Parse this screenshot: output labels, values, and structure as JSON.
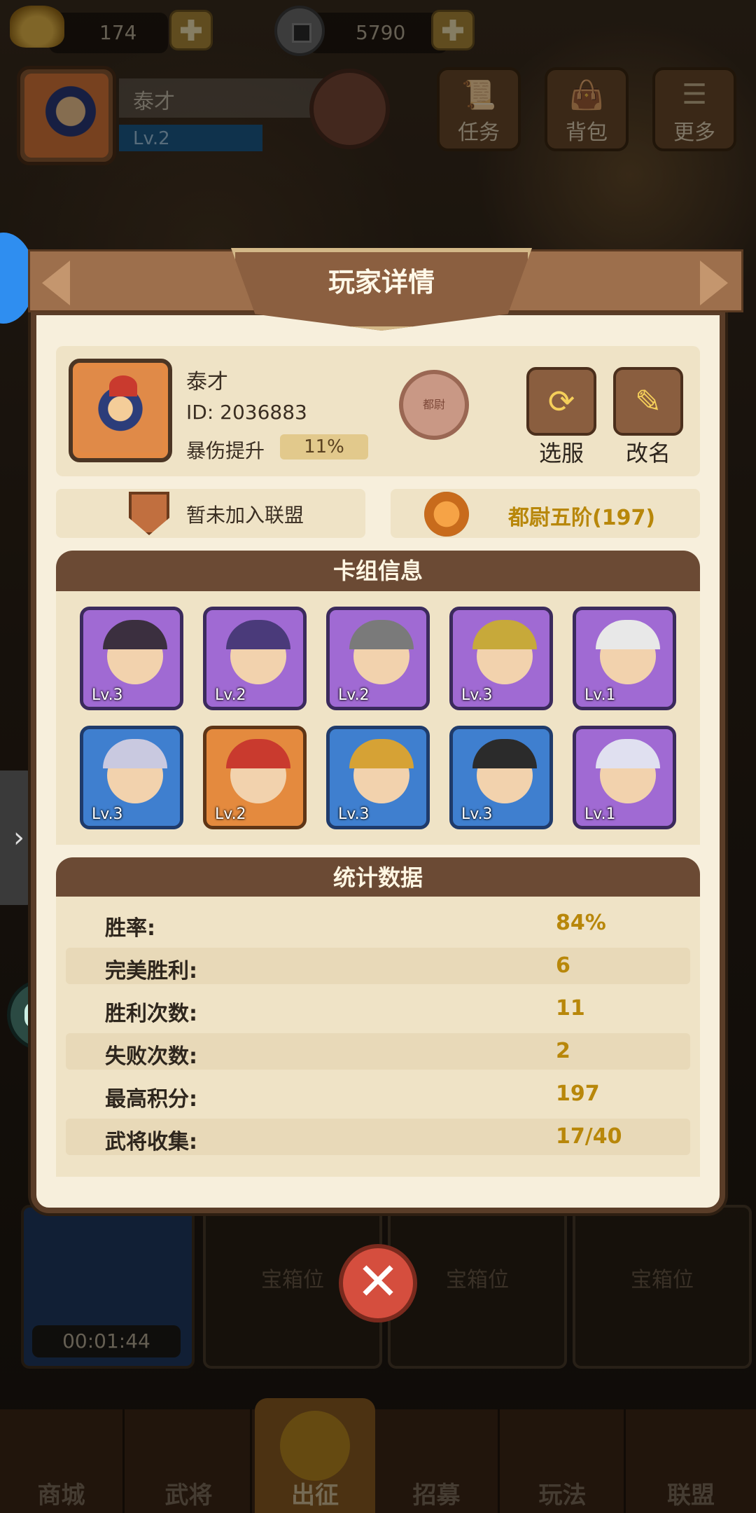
{
  "top_bar": {
    "gold": "174",
    "coins": "5790"
  },
  "header": {
    "name": "泰才",
    "level": "Lv.2",
    "rank_seal_text": "都尉",
    "buttons": [
      {
        "label": "任务",
        "icon": "scroll-icon"
      },
      {
        "label": "背包",
        "icon": "bag-icon"
      },
      {
        "label": "更多",
        "icon": "list-icon"
      }
    ]
  },
  "modal": {
    "title": "玩家详情",
    "player": {
      "name": "泰才",
      "id_text": "ID: 2036883",
      "crit_label": "暴伤提升",
      "crit_value": "11%",
      "seal_text": "都尉"
    },
    "actions": {
      "switch_server": "选服",
      "rename": "改名"
    },
    "alliance_text": "暂未加入联盟",
    "rank_text": "都尉五阶(197)",
    "deck": {
      "title": "卡组信息",
      "cards": [
        {
          "level": "Lv.3",
          "rarity": "purple"
        },
        {
          "level": "Lv.2",
          "rarity": "purple"
        },
        {
          "level": "Lv.2",
          "rarity": "purple"
        },
        {
          "level": "Lv.3",
          "rarity": "purple"
        },
        {
          "level": "Lv.1",
          "rarity": "purple"
        },
        {
          "level": "Lv.3",
          "rarity": "blue"
        },
        {
          "level": "Lv.2",
          "rarity": "orange"
        },
        {
          "level": "Lv.3",
          "rarity": "blue"
        },
        {
          "level": "Lv.3",
          "rarity": "blue"
        },
        {
          "level": "Lv.1",
          "rarity": "purple"
        }
      ]
    },
    "stats": {
      "title": "统计数据",
      "rows": [
        {
          "label": "胜率:",
          "value": "84%"
        },
        {
          "label": "完美胜利:",
          "value": "6"
        },
        {
          "label": "胜利次数:",
          "value": "11"
        },
        {
          "label": "失败次数:",
          "value": "2"
        },
        {
          "label": "最高积分:",
          "value": "197"
        },
        {
          "label": "武将收集:",
          "value": "17/40"
        }
      ]
    }
  },
  "chests": {
    "timer": "00:01:44",
    "slot_label": "宝箱位"
  },
  "nav": {
    "items": [
      "商城",
      "武将",
      "出征",
      "招募",
      "玩法",
      "联盟"
    ]
  },
  "colors": {
    "stat_value": "#b8870a",
    "panel_bg": "#f7efdc",
    "section_header": "#6b4a34",
    "purple_card": "#a06ad3",
    "blue_card": "#3f7fcf",
    "orange_card": "#e48a3e"
  }
}
